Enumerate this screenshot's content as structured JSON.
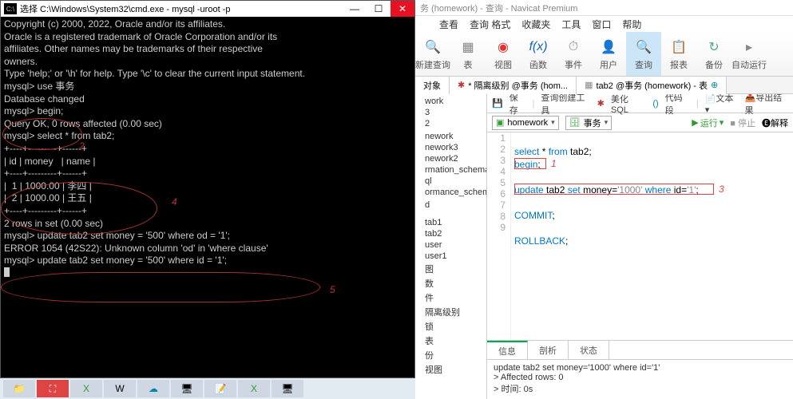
{
  "terminal": {
    "title": "选择 C:\\Windows\\System32\\cmd.exe - mysql -uroot -p",
    "lines": [
      "Copyright (c) 2000, 2022, Oracle and/or its affiliates.",
      "",
      "Oracle is a registered trademark of Oracle Corporation and/or its",
      "affiliates. Other names may be trademarks of their respective",
      "owners.",
      "",
      "Type 'help;' or '\\h' for help. Type '\\c' to clear the current input statement.",
      "",
      "mysql> use 事务",
      "Database changed",
      "mysql> begin;",
      "Query OK, 0 rows affected (0.00 sec)",
      "",
      "mysql> select * from tab2;",
      "+----+---------+------+",
      "| id | money   | name |",
      "+----+---------+------+",
      "|  1 | 1000.00 | 李四 |",
      "|  2 | 1000.00 | 王五 |",
      "+----+---------+------+",
      "2 rows in set (0.00 sec)",
      "",
      "mysql> update tab2 set money = '500' where od = '1';",
      "ERROR 1054 (42S22): Unknown column 'od' in 'where clause'",
      "mysql> update tab2 set money = '500' where id = '1';"
    ],
    "annotations": {
      "a2": "2",
      "a4": "4",
      "a5": "5"
    }
  },
  "navicat": {
    "title": "务 (homework) - 查询 - Navicat Premium",
    "menu": [
      "查看",
      "查询 格式",
      "收藏夹",
      "工具",
      "窗口",
      "帮助"
    ],
    "ribbon": [
      {
        "label": "新建查询",
        "icon": "🔍",
        "color": "#1565c0"
      },
      {
        "label": "表",
        "icon": "▦",
        "color": "#888"
      },
      {
        "label": "视图",
        "icon": "◉",
        "color": "#d33"
      },
      {
        "label": "函数",
        "icon": "f(x)",
        "color": "#1565c0",
        "italic": true
      },
      {
        "label": "事件",
        "icon": "⏱",
        "color": "#888"
      },
      {
        "label": "用户",
        "icon": "👤",
        "color": "#888"
      },
      {
        "label": "查询",
        "icon": "🔍",
        "color": "#f7a",
        "active": true
      },
      {
        "label": "报表",
        "icon": "📋",
        "color": "#e88"
      },
      {
        "label": "备份",
        "icon": "↻",
        "color": "#5a8"
      },
      {
        "label": "自动运行",
        "icon": "▸",
        "color": "#888"
      }
    ],
    "tabs": {
      "left": "对象",
      "mid": "* 隔离级别 @事务 (hom...",
      "right": "tab2 @事务 (homework) - 表"
    },
    "toolbar": [
      "保存",
      "查询创建工具",
      "美化 SQL",
      "代码段",
      "文本",
      "导出结果"
    ],
    "combos": {
      "db": "homework",
      "schema": "事务",
      "run": "运行",
      "stop": "停止",
      "explain": "解释"
    },
    "tree": [
      "work",
      "3",
      "2",
      "",
      "nework",
      "nework3",
      "nework2",
      "rmation_schema",
      "ql",
      "ormance_schema",
      "",
      "d",
      "",
      "",
      "",
      "",
      "tab1",
      "tab2",
      "user",
      "user1",
      "图",
      "数",
      "件",
      "隔离级别",
      "锁",
      "表",
      "份",
      "视图"
    ],
    "code": {
      "l1": "",
      "l2": {
        "pre": "select",
        "mid": " * ",
        "from": "from",
        "rest": " tab2;"
      },
      "l3": {
        "kw": "begin",
        "rest": ";"
      },
      "l4": "",
      "l5": {
        "update": "update",
        "t": " tab2 ",
        "set": "set",
        "m": " money=",
        "s1": "'1000'",
        "w": " where",
        "id": " id=",
        "s2": "'1'",
        "end": ";"
      },
      "l6": "",
      "l7": {
        "kw": "COMMIT",
        "rest": ";"
      },
      "l8": "",
      "l9": {
        "kw": "ROLLBACK",
        "rest": ";"
      }
    },
    "annotations": {
      "a1": "1",
      "a3": "3"
    },
    "bottom_tabs": [
      "信息",
      "剖析",
      "状态"
    ],
    "messages": [
      "update tab2 set money='1000' where id='1'",
      "> Affected rows: 0",
      "> 时间: 0s"
    ]
  }
}
